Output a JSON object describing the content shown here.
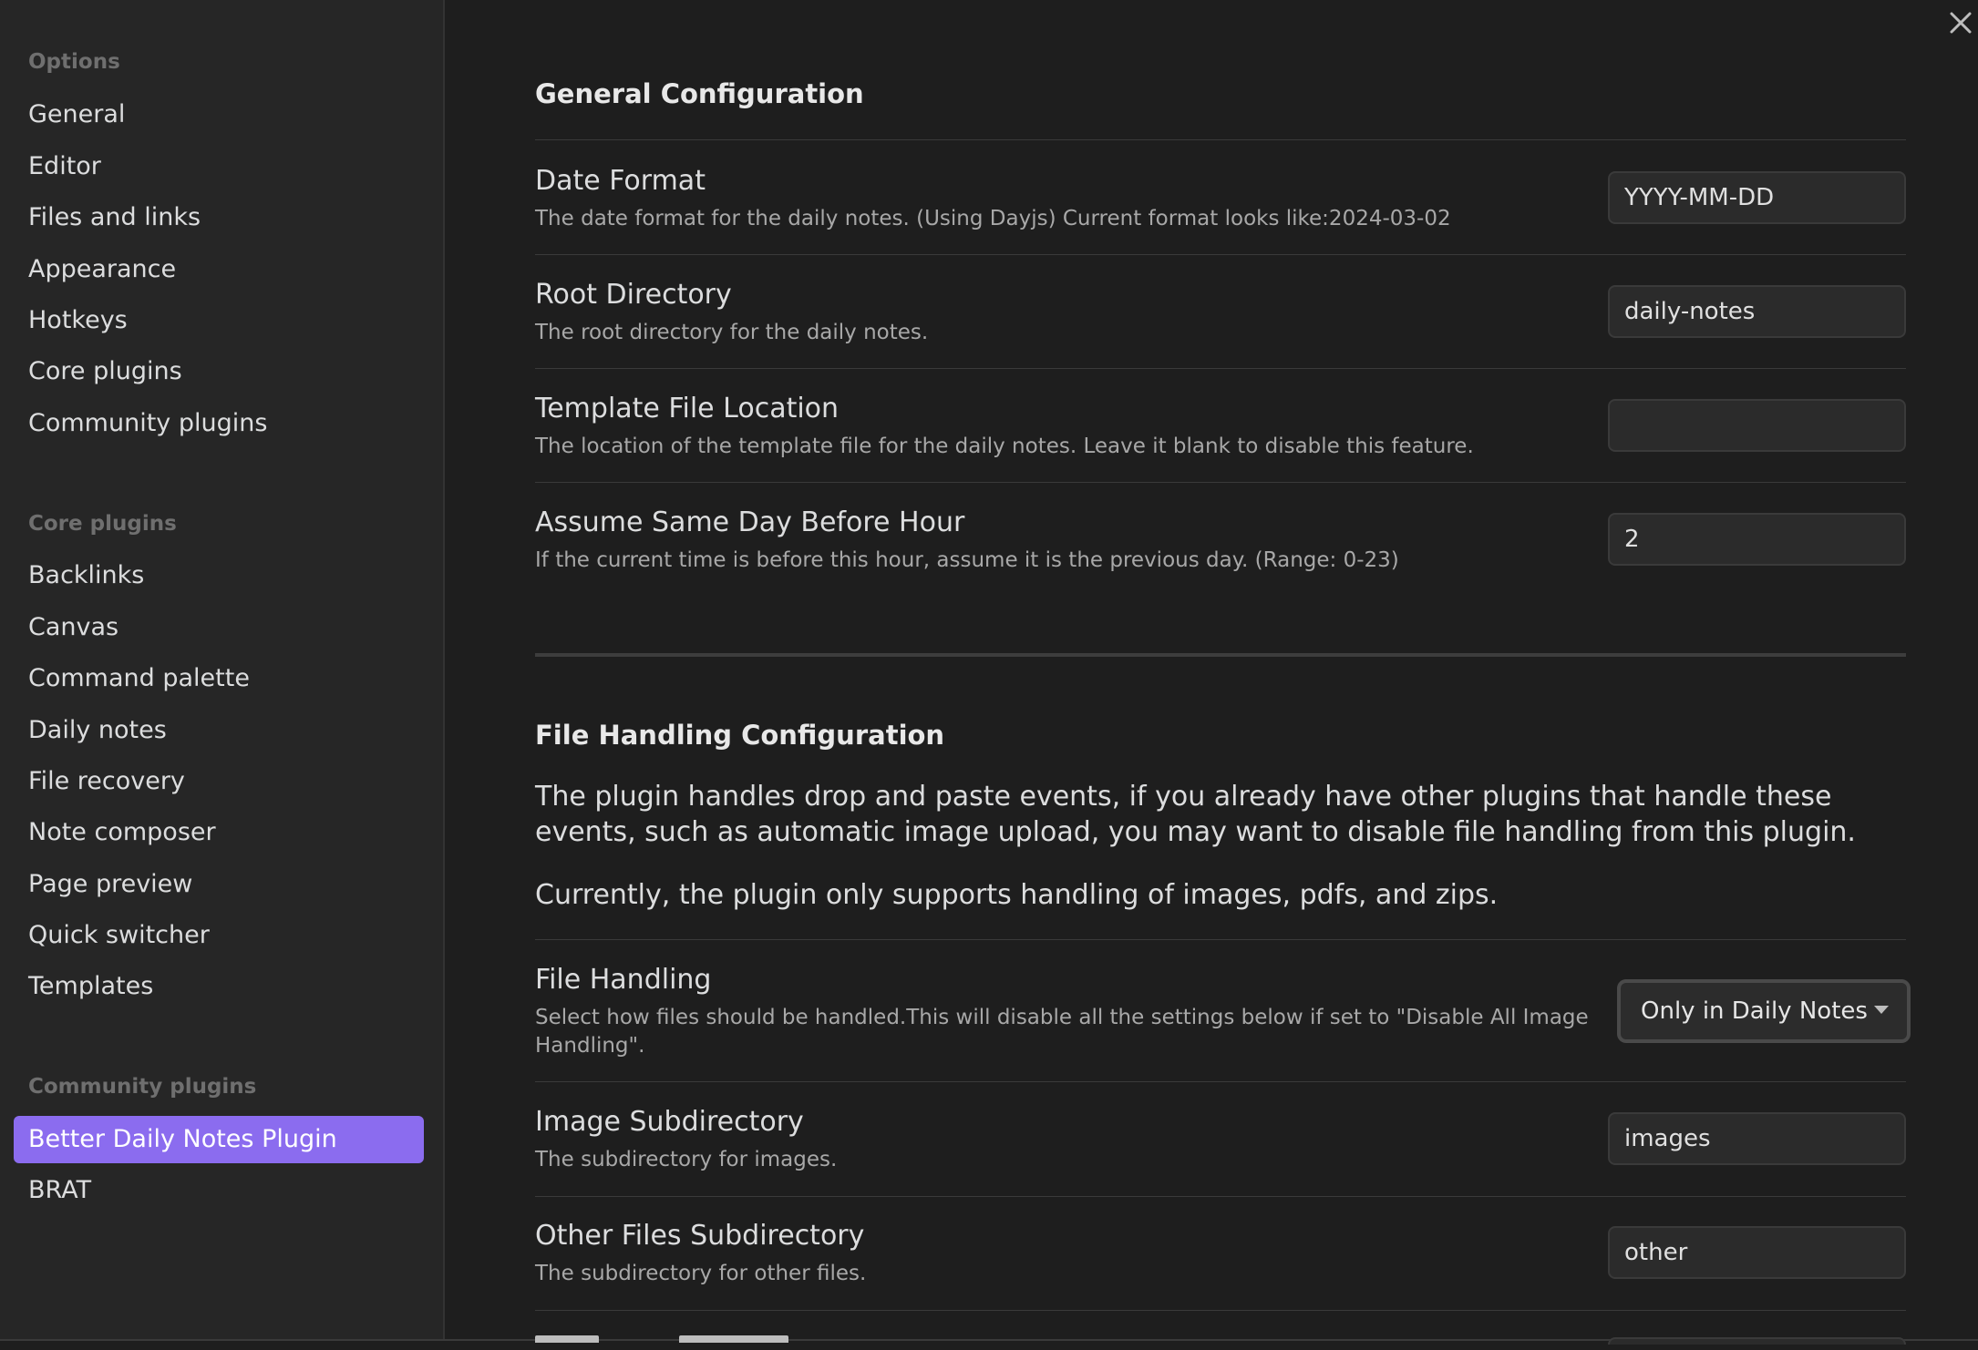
{
  "sidebar": {
    "options_heading": "Options",
    "options_items": [
      "General",
      "Editor",
      "Files and links",
      "Appearance",
      "Hotkeys",
      "Core plugins",
      "Community plugins"
    ],
    "core_heading": "Core plugins",
    "core_items": [
      "Backlinks",
      "Canvas",
      "Command palette",
      "Daily notes",
      "File recovery",
      "Note composer",
      "Page preview",
      "Quick switcher",
      "Templates"
    ],
    "community_heading": "Community plugins",
    "community_items": [
      "Better Daily Notes Plugin",
      "BRAT"
    ],
    "active_item": "Better Daily Notes Plugin",
    "accent_color": "#8b6cef"
  },
  "close_icon": "close-icon",
  "general": {
    "title": "General Configuration",
    "date_format": {
      "name": "Date Format",
      "desc": "The date format for the daily notes. (Using Dayjs) Current format looks like:2024-03-02",
      "value": "YYYY-MM-DD"
    },
    "root_directory": {
      "name": "Root Directory",
      "desc": "The root directory for the daily notes.",
      "value": "daily-notes"
    },
    "template_location": {
      "name": "Template File Location",
      "desc": "The location of the template file for the daily notes. Leave it blank to disable this feature.",
      "value": ""
    },
    "same_day_hour": {
      "name": "Assume Same Day Before Hour",
      "desc": "If the current time is before this hour, assume it is the previous day. (Range: 0-23)",
      "value": "2"
    }
  },
  "file_handling": {
    "title": "File Handling Configuration",
    "para1": "The plugin handles drop and paste events, if you already have other plugins that handle these events, such as automatic image upload, you may want to disable file handling from this plugin.",
    "para2": "Currently, the plugin only supports handling of images, pdfs, and zips.",
    "mode": {
      "name": "File Handling",
      "desc": "Select how files should be handled.This will disable all the settings below if set to \"Disable All Image Handling\".",
      "selected": "Only in Daily Notes"
    },
    "image_subdir": {
      "name": "Image Subdirectory",
      "desc": "The subdirectory for images.",
      "value": "images"
    },
    "other_subdir": {
      "name": "Other Files Subdirectory",
      "desc": "The subdirectory for other files.",
      "value": "other"
    }
  }
}
